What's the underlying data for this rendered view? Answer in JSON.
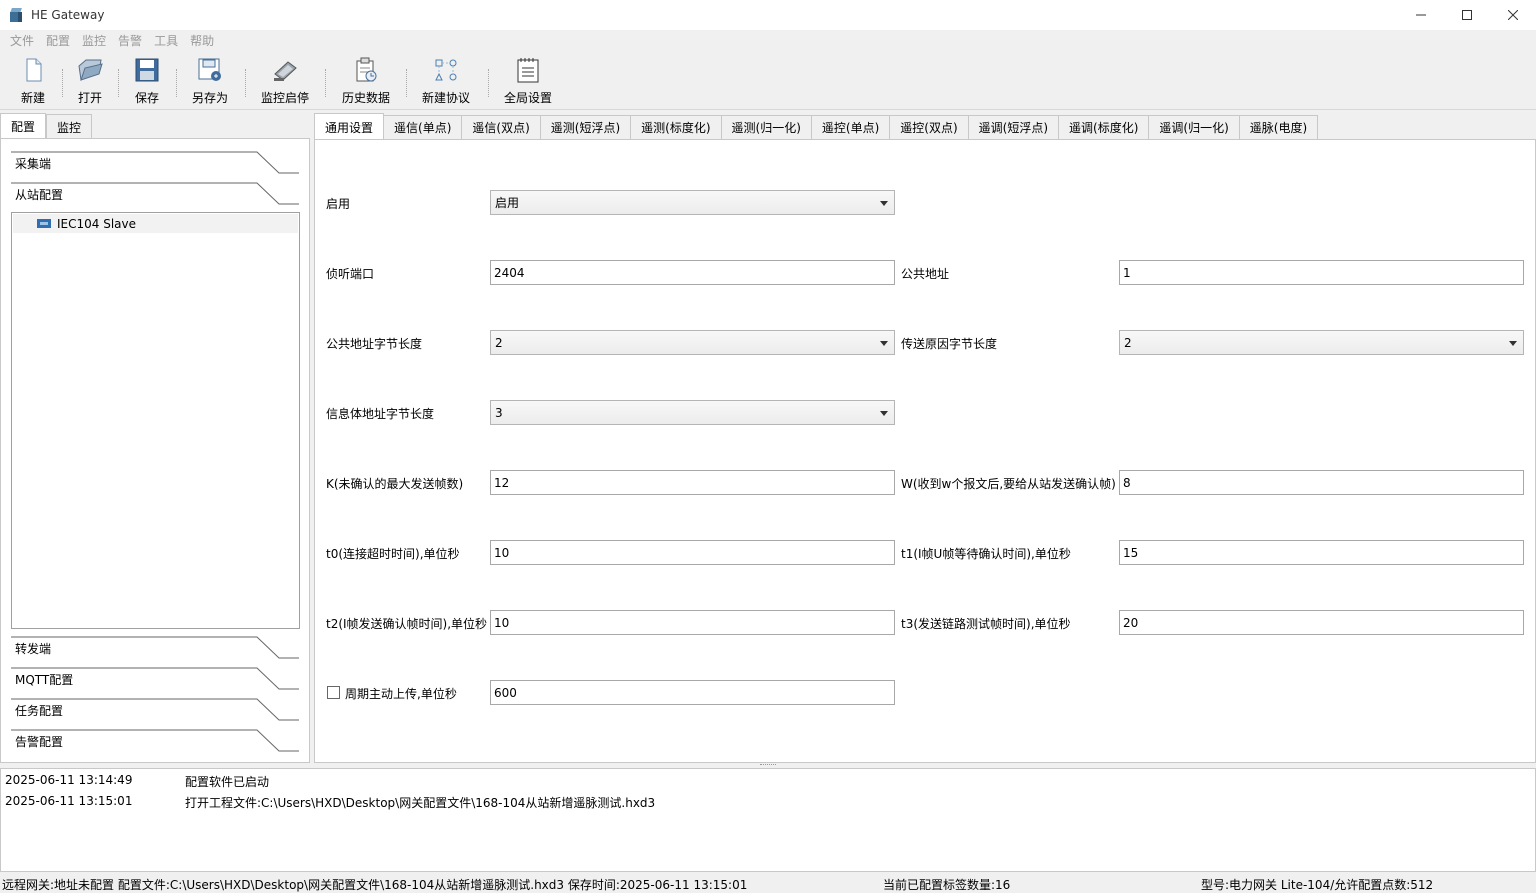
{
  "window": {
    "title": "HE Gateway",
    "icon": "app-cube-icon"
  },
  "menu": [
    "文件",
    "配置",
    "监控",
    "告警",
    "工具",
    "帮助"
  ],
  "toolbar": [
    {
      "label": "新建",
      "icon": "new-file-icon"
    },
    {
      "label": "打开",
      "icon": "open-folder-icon"
    },
    {
      "label": "保存",
      "icon": "save-disk-icon"
    },
    {
      "label": "另存为",
      "icon": "save-as-icon"
    },
    {
      "label": "监控启停",
      "icon": "monitor-toggle-icon"
    },
    {
      "label": "历史数据",
      "icon": "history-data-icon"
    },
    {
      "label": "新建协议",
      "icon": "new-protocol-icon"
    },
    {
      "label": "全局设置",
      "icon": "global-settings-icon"
    }
  ],
  "left_tabs": [
    "配置",
    "监控"
  ],
  "left_sections": {
    "top": [
      "采集端",
      "从站配置"
    ],
    "bottom": [
      "转发端",
      "MQTT配置",
      "任务配置",
      "告警配置"
    ]
  },
  "tree": {
    "item": "IEC104 Slave"
  },
  "right_tabs": [
    "通用设置",
    "遥信(单点)",
    "遥信(双点)",
    "遥测(短浮点)",
    "遥测(标度化)",
    "遥测(归一化)",
    "遥控(单点)",
    "遥控(双点)",
    "遥调(短浮点)",
    "遥调(标度化)",
    "遥调(归一化)",
    "遥脉(电度)"
  ],
  "form": {
    "enable_label": "启用",
    "enable_value": "启用",
    "listen_port_label": "侦听端口",
    "listen_port_value": "2404",
    "common_addr_label": "公共地址",
    "common_addr_value": "1",
    "common_addr_len_label": "公共地址字节长度",
    "common_addr_len_value": "2",
    "cot_len_label": "传送原因字节长度",
    "cot_len_value": "2",
    "ioa_len_label": "信息体地址字节长度",
    "ioa_len_value": "3",
    "k_label": "K(未确认的最大发送帧数)",
    "k_value": "12",
    "w_label": "W(收到w个报文后,要给从站发送确认帧)",
    "w_value": "8",
    "t0_label": "t0(连接超时时间),单位秒",
    "t0_value": "10",
    "t1_label": "t1(I帧U帧等待确认时间),单位秒",
    "t1_value": "15",
    "t2_label": "t2(I帧发送确认帧时间),单位秒",
    "t2_value": "10",
    "t3_label": "t3(发送链路测试帧时间),单位秒",
    "t3_value": "20",
    "periodic_label": "周期主动上传,单位秒",
    "periodic_value": "600",
    "periodic_checked": false
  },
  "log": [
    {
      "time": "2025-06-11 13:14:49",
      "message": "配置软件已启动"
    },
    {
      "time": "2025-06-11 13:15:01",
      "message": "打开工程文件:C:\\Users\\HXD\\Desktop\\网关配置文件\\168-104从站新增遥脉测试.hxd3"
    }
  ],
  "status": {
    "left": "远程网关:地址未配置  配置文件:C:\\Users\\HXD\\Desktop\\网关配置文件\\168-104从站新增遥脉测试.hxd3  保存时间:2025-06-11 13:15:01",
    "middle": "当前已配置标签数量:16",
    "right": "型号:电力网关 Lite-104/允许配置点数:512"
  }
}
